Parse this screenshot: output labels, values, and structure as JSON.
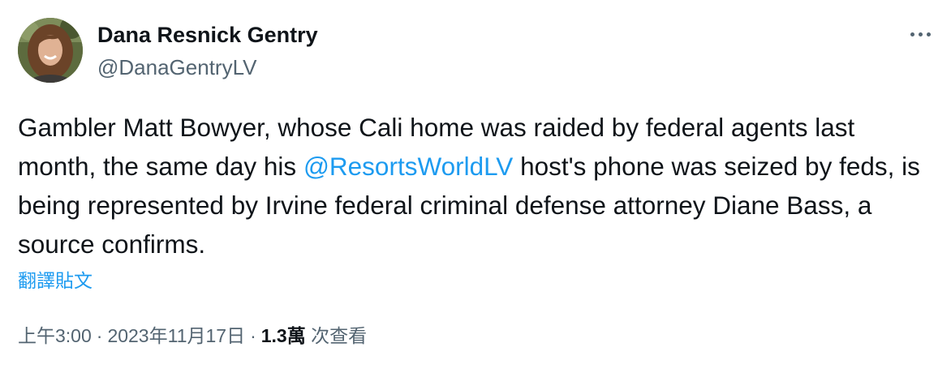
{
  "author": {
    "name": "Dana Resnick Gentry",
    "handle": "@DanaGentryLV"
  },
  "more_icon": "ellipsis-icon",
  "tweet": {
    "text_before": "Gambler Matt Bowyer, whose Cali home was raided by federal agents last month, the same day his ",
    "mention": "@ResortsWorldLV",
    "text_after": " host's phone was seized by feds, is being represented by Irvine federal criminal defense attorney Diane Bass, a source confirms."
  },
  "translate_label": "翻譯貼文",
  "meta": {
    "time": "上午3:00",
    "separator": "·",
    "date": "2023年11月17日",
    "views_count": "1.3萬",
    "views_label": "次查看"
  },
  "colors": {
    "link": "#1d9bf0",
    "secondary_text": "#536471",
    "primary_text": "#0f1419"
  }
}
